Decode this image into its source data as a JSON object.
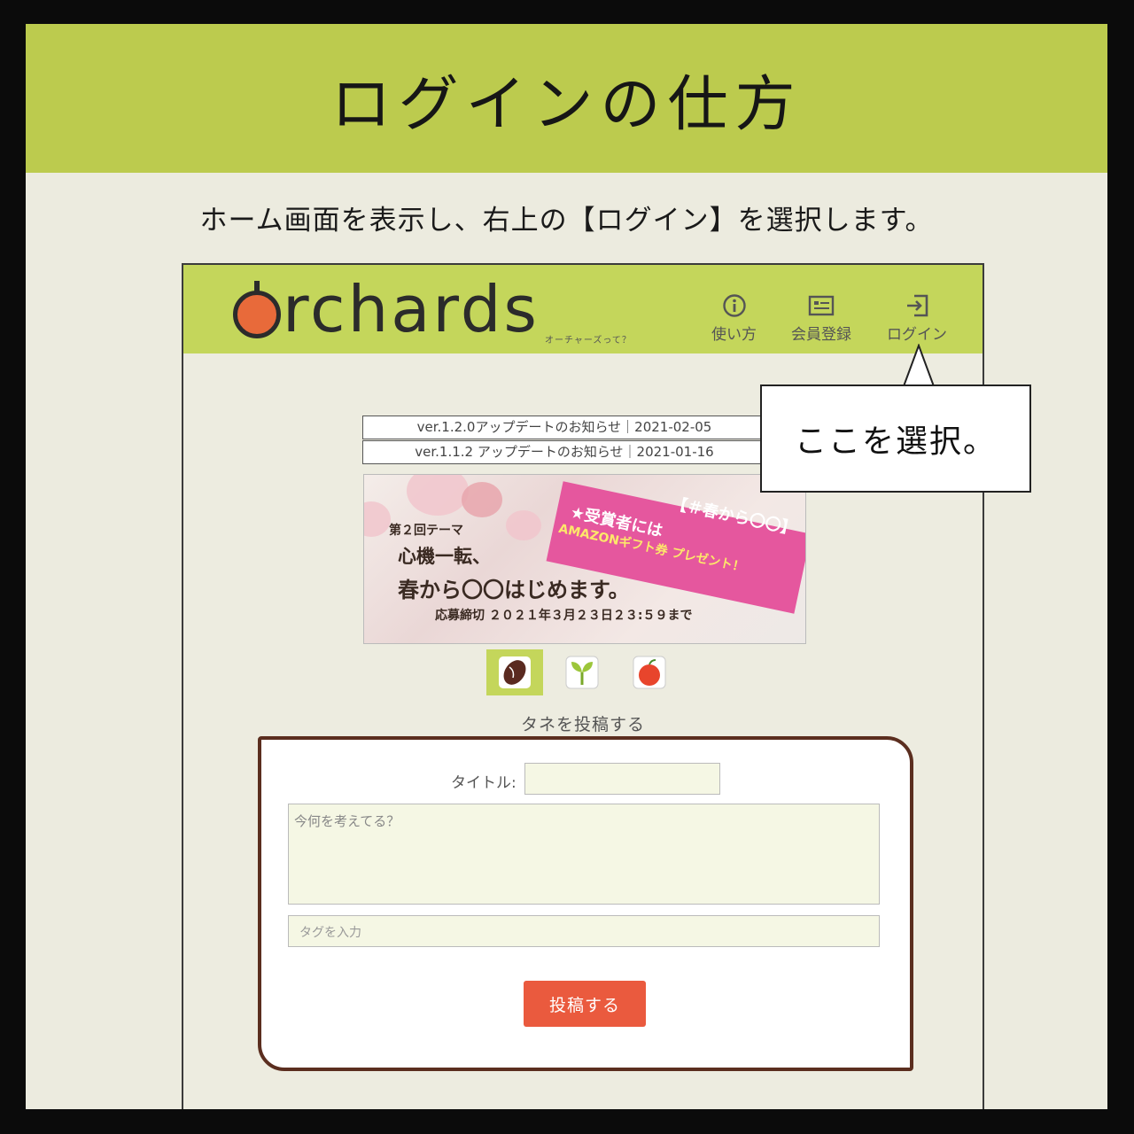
{
  "slide": {
    "title": "ログインの仕方",
    "instruction": "ホーム画面を表示し、右上の【ログイン】を選択します。",
    "callout": "ここを選択。"
  },
  "app": {
    "logo_rest": "rchards",
    "logo_sub": "オーチャーズって？",
    "nav": [
      {
        "label": "使い方",
        "icon": "info-icon"
      },
      {
        "label": "会員登録",
        "icon": "id-card-icon"
      },
      {
        "label": "ログイン",
        "icon": "login-icon"
      }
    ],
    "news": [
      "ver.1.2.0アップデートのお知らせ｜2021-02-05",
      "ver.1.1.2 アップデートのお知らせ｜2021-01-16"
    ],
    "banner": {
      "theme_label": "第２回テーマ",
      "line1": "心機一転、",
      "line2": "春から〇〇はじめます。",
      "deadline": "応募締切 ２０２１年３月２３日２３:５９まで",
      "band_line1": "【＃春から〇〇】",
      "band_line2": "★受賞者には",
      "band_line3": "AMAZONギフト券 プレゼント！"
    },
    "categories": [
      "seed-icon",
      "sprout-icon",
      "apple-icon"
    ],
    "post_label": "タネを投稿する",
    "form": {
      "title_label": "タイトル:",
      "body_placeholder": "今何を考えてる？",
      "tag_placeholder": "タグを入力",
      "submit": "投稿する"
    }
  },
  "colors": {
    "title_band": "#bccb4e",
    "app_header": "#c4d65b",
    "submit": "#ea5a3e",
    "form_border": "#5b2e1f",
    "logo_accent": "#e86a3a"
  }
}
